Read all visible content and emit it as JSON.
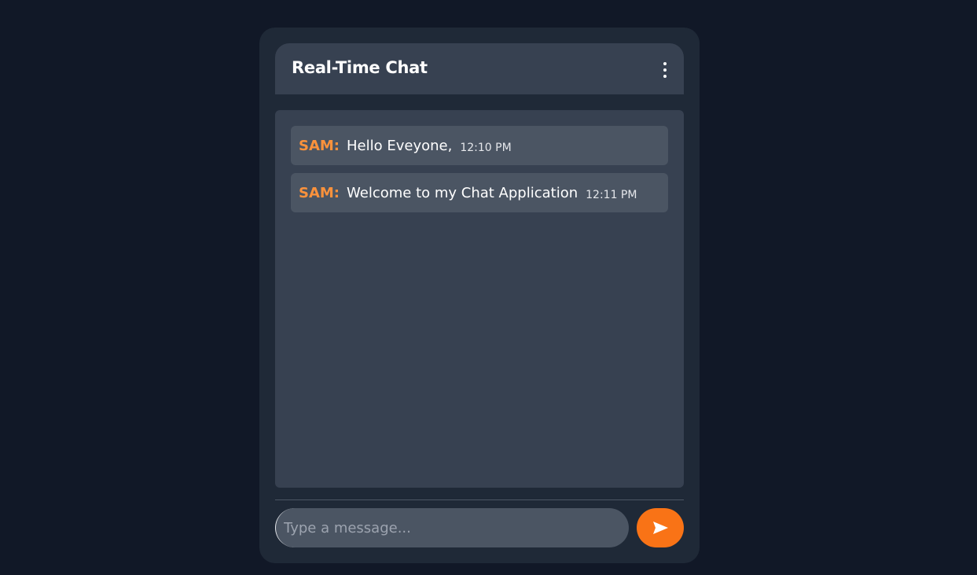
{
  "header": {
    "title": "Real-Time Chat",
    "menu_icon": "more-vertical-icon"
  },
  "messages": [
    {
      "sender": "SAM:",
      "text": "Hello Eveyone,",
      "time": "12:10 PM"
    },
    {
      "sender": "SAM:",
      "text": "Welcome to my Chat Application",
      "time": "12:11 PM"
    }
  ],
  "composer": {
    "value": "",
    "placeholder": "Type a message...",
    "send_icon": "send-icon"
  },
  "colors": {
    "page_background": "#111827",
    "card_background": "#1f2937",
    "panel_background": "#374151",
    "bubble_background": "#4b5563",
    "accent": "#f97316",
    "sender_name": "#fb923c"
  }
}
